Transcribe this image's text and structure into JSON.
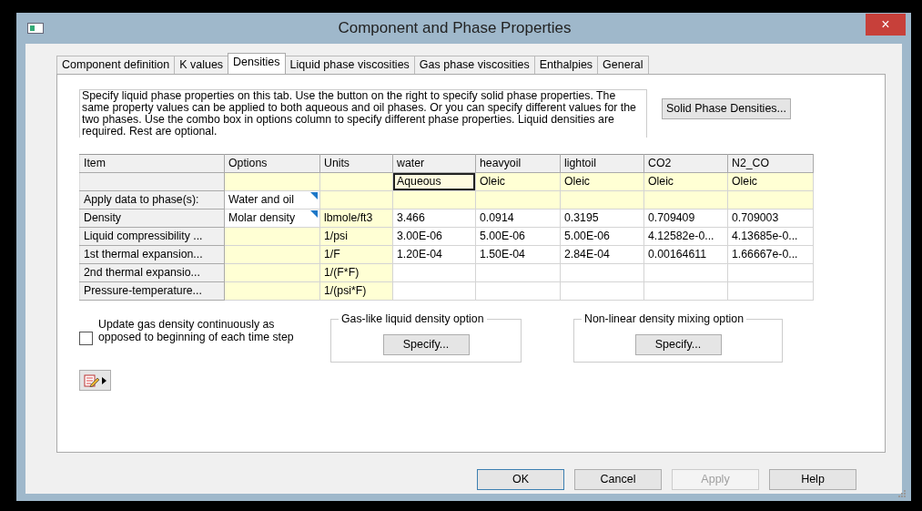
{
  "window": {
    "title": "Component and Phase Properties",
    "close": "×"
  },
  "tabs": [
    {
      "label": "Component definition",
      "selected": false
    },
    {
      "label": "K values",
      "selected": false
    },
    {
      "label": "Densities",
      "selected": true
    },
    {
      "label": "Liquid phase viscosities",
      "selected": false
    },
    {
      "label": "Gas phase viscosities",
      "selected": false
    },
    {
      "label": "Enthalpies",
      "selected": false
    },
    {
      "label": "General",
      "selected": false
    }
  ],
  "description": "Specify liquid phase properties on this tab. Use the button on the right to specify solid phase properties. The same property values can be applied to both aqueous and oil phases. Or you can specify different values for the two phases. Use the combo box in options column to specify different phase properties. Liquid densities are required. Rest are optional.",
  "solid_button": "Solid Phase Densities...",
  "grid": {
    "columns": [
      "Item",
      "Options",
      "Units",
      "water",
      "heavyoil",
      "lightoil",
      "CO2",
      "N2_CO"
    ],
    "rows": [
      {
        "options_shaded": true,
        "options_dropdown": false,
        "values_shaded": true,
        "values": [
          {
            "text": "Aqueous",
            "selected": true
          },
          {
            "text": "Oleic",
            "selected": false
          },
          {
            "text": "Oleic",
            "selected": false
          },
          {
            "text": "Oleic",
            "selected": false
          },
          {
            "text": "Oleic",
            "selected": false
          }
        ]
      },
      {
        "item": "Apply data to phase(s):",
        "options": "Water and oil",
        "options_shaded": false,
        "options_dropdown": true,
        "values_shaded": true,
        "values": []
      },
      {
        "item": "Density",
        "options": "Molar density",
        "options_shaded": false,
        "options_dropdown": true,
        "units": "lbmole/ft3",
        "values_shaded": false,
        "values": [
          {
            "text": "3.466",
            "selected": false
          },
          {
            "text": "0.0914",
            "selected": false
          },
          {
            "text": "0.3195",
            "selected": false
          },
          {
            "text": "0.709409",
            "selected": false
          },
          {
            "text": "0.709003",
            "selected": false
          }
        ]
      },
      {
        "item": "Liquid compressibility ...",
        "options_shaded": true,
        "options_dropdown": false,
        "units": "1/psi",
        "values_shaded": false,
        "values": [
          {
            "text": "3.00E-06",
            "selected": false
          },
          {
            "text": "5.00E-06",
            "selected": false
          },
          {
            "text": "5.00E-06",
            "selected": false
          },
          {
            "text": "4.12582e-0...",
            "selected": false
          },
          {
            "text": "4.13685e-0...",
            "selected": false
          }
        ]
      },
      {
        "item": "1st thermal expansion...",
        "options_shaded": true,
        "options_dropdown": false,
        "units": "1/F",
        "values_shaded": false,
        "values": [
          {
            "text": "1.20E-04",
            "selected": false
          },
          {
            "text": "1.50E-04",
            "selected": false
          },
          {
            "text": "2.84E-04",
            "selected": false
          },
          {
            "text": "0.00164611",
            "selected": false
          },
          {
            "text": "1.66667e-0...",
            "selected": false
          }
        ]
      },
      {
        "item": "2nd thermal expansio...",
        "options_shaded": true,
        "options_dropdown": false,
        "units": "1/(F*F)",
        "values_shaded": false,
        "values": []
      },
      {
        "item": "Pressure-temperature...",
        "options_shaded": true,
        "options_dropdown": false,
        "units": "1/(psi*F)",
        "values_shaded": false,
        "values": []
      }
    ]
  },
  "update_checkbox": {
    "label": "Update gas density continuously as opposed to beginning of each time step",
    "checked": false
  },
  "groups": [
    {
      "title": "Gas-like liquid density option",
      "button": "Specify..."
    },
    {
      "title": "Non-linear density mixing option",
      "button": "Specify..."
    }
  ],
  "buttons": [
    {
      "label": "OK",
      "default": true,
      "disabled": false
    },
    {
      "label": "Cancel",
      "default": false,
      "disabled": false
    },
    {
      "label": "Apply",
      "default": false,
      "disabled": true
    },
    {
      "label": "Help",
      "default": false,
      "disabled": false
    }
  ]
}
